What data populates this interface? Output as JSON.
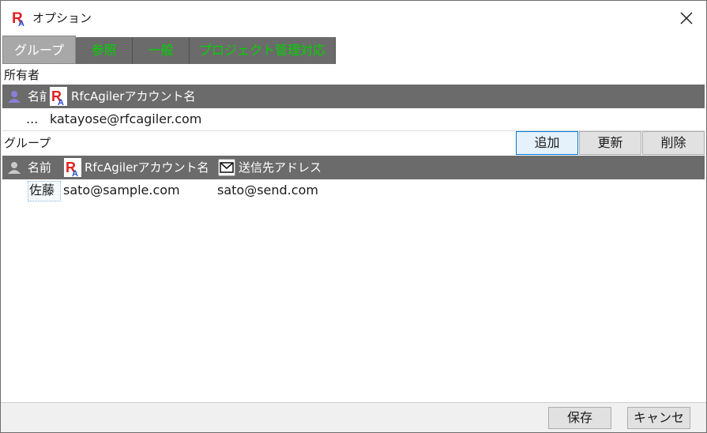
{
  "window": {
    "title": "オプション"
  },
  "tabs": [
    {
      "label": "グループ",
      "active": true
    },
    {
      "label": "参照",
      "active": false
    },
    {
      "label": "一般",
      "active": false
    },
    {
      "label": "プロジェクト管理対応",
      "active": false
    }
  ],
  "owner": {
    "section_label": "所有者",
    "columns": {
      "name": "名前",
      "account": "RfcAgilerアカウント名"
    },
    "row": {
      "name": "...",
      "account": "katayose@rfcagiler.com"
    }
  },
  "group": {
    "section_label": "グループ",
    "buttons": {
      "add": "追加",
      "update": "更新",
      "delete": "削除"
    },
    "columns": {
      "name": "名前",
      "account": "RfcAgilerアカウント名",
      "send_address": "送信先アドレス"
    },
    "rows": [
      {
        "name": "佐藤",
        "account": "sato@sample.com",
        "send_address": "sato@send.com"
      }
    ]
  },
  "footer": {
    "save_label": "保存",
    "cancel_label": "キャンセル"
  },
  "colors": {
    "tab_bg": "#6b6b6b",
    "tab_text": "#00d400",
    "grid_header_bg": "#6b6b6b",
    "logo_red": "#e02020",
    "logo_blue": "#2a4fd0"
  }
}
